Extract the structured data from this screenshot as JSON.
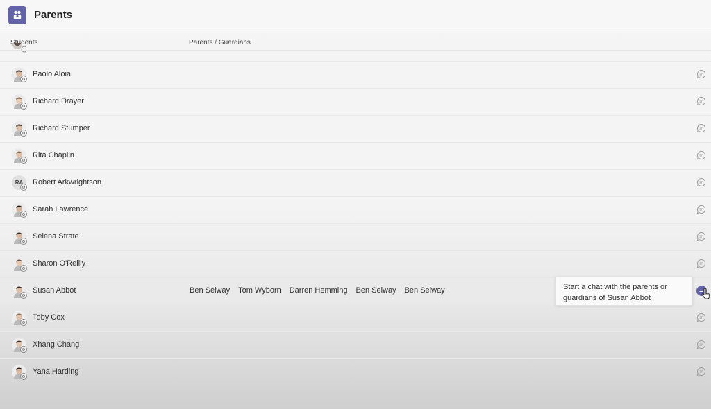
{
  "header": {
    "title": "Parents",
    "icon": "people-icon",
    "accent_color": "#6264a7"
  },
  "columns": {
    "students": "Students",
    "parents": "Parents / Guardians"
  },
  "rows": [
    {
      "name": "Paolo Aloia",
      "initials": "",
      "parents": []
    },
    {
      "name": "Richard Drayer",
      "initials": "",
      "parents": []
    },
    {
      "name": "Richard Stumper",
      "initials": "",
      "parents": []
    },
    {
      "name": "Rita Chaplin",
      "initials": "",
      "parents": []
    },
    {
      "name": "Robert Arkwrightson",
      "initials": "RA",
      "parents": []
    },
    {
      "name": "Sarah Lawrence",
      "initials": "",
      "parents": []
    },
    {
      "name": "Selena Strate",
      "initials": "",
      "parents": []
    },
    {
      "name": "Sharon O'Reilly",
      "initials": "",
      "parents": []
    },
    {
      "name": "Susan Abbot",
      "initials": "",
      "parents": [
        "Ben Selway",
        "Tom Wyborn",
        "Darren Hemming",
        "Ben Selway",
        "Ben Selway"
      ]
    },
    {
      "name": "Toby Cox",
      "initials": "",
      "parents": []
    },
    {
      "name": "Xhang Chang",
      "initials": "",
      "parents": []
    },
    {
      "name": "Yana Harding",
      "initials": "",
      "parents": []
    }
  ],
  "tooltip": {
    "text": "Start a chat with the parents or guardians of Susan Abbot"
  }
}
